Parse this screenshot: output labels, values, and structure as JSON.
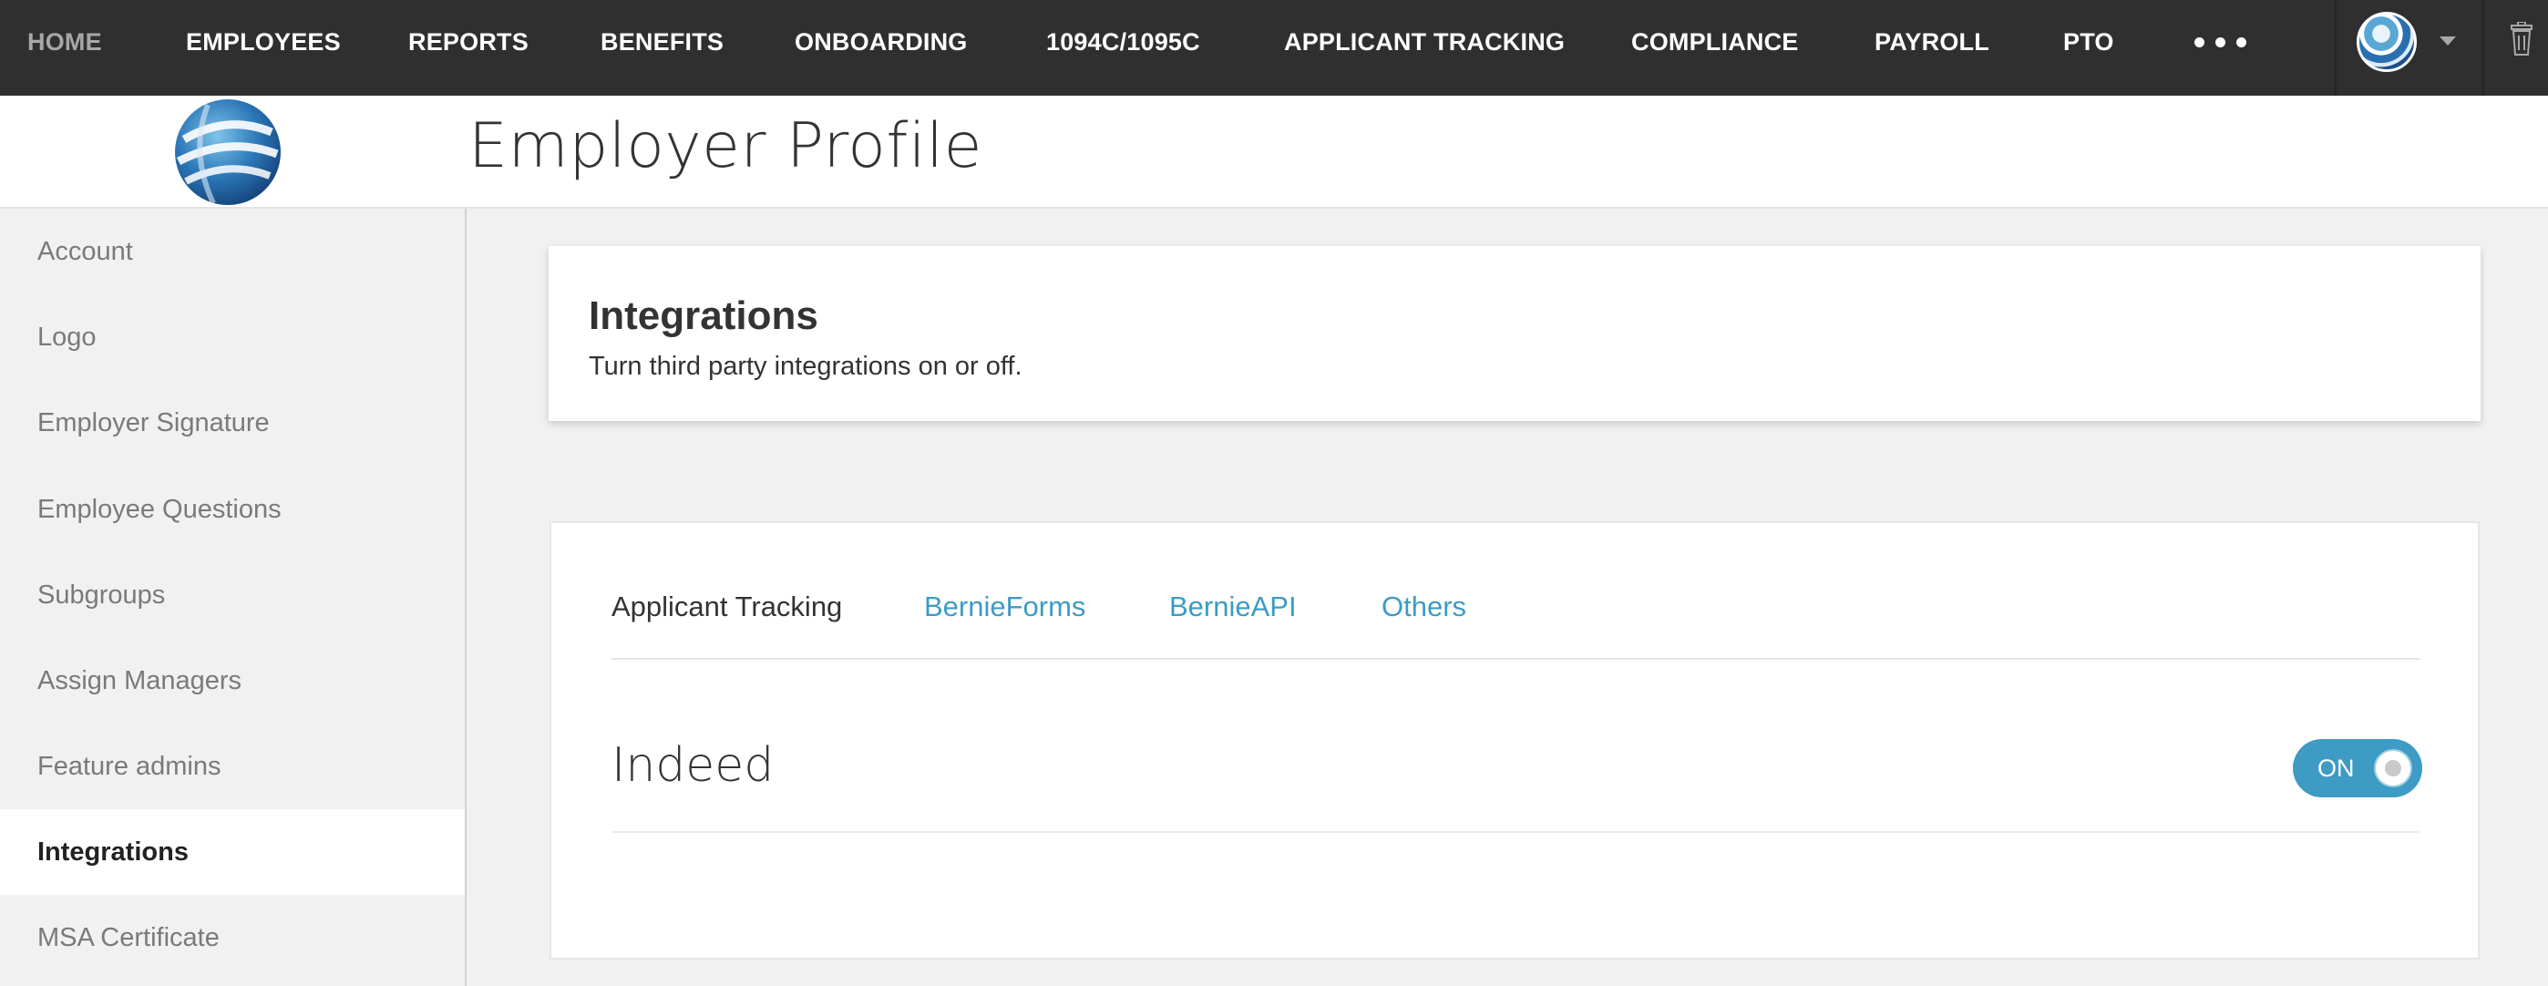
{
  "topnav": {
    "items": [
      {
        "label": "HOME"
      },
      {
        "label": "EMPLOYEES"
      },
      {
        "label": "REPORTS"
      },
      {
        "label": "BENEFITS"
      },
      {
        "label": "ONBOARDING"
      },
      {
        "label": "1094C/1095C"
      },
      {
        "label": "APPLICANT TRACKING"
      },
      {
        "label": "COMPLIANCE"
      },
      {
        "label": "PAYROLL"
      },
      {
        "label": "PTO"
      }
    ],
    "more_icon": "ellipsis-icon",
    "avatar_icon": "globe-logo-icon",
    "caret_icon": "caret-down-icon",
    "trash_icon": "trash-icon"
  },
  "header": {
    "logo_icon": "globe-logo-icon",
    "title": "Employer Profile"
  },
  "sidebar": {
    "items": [
      {
        "label": "Account"
      },
      {
        "label": "Logo"
      },
      {
        "label": "Employer Signature"
      },
      {
        "label": "Employee Questions"
      },
      {
        "label": "Subgroups"
      },
      {
        "label": "Assign Managers"
      },
      {
        "label": "Feature admins"
      },
      {
        "label": "Integrations"
      },
      {
        "label": "MSA Certificate"
      }
    ],
    "active": "Integrations"
  },
  "intro": {
    "title": "Integrations",
    "subtitle": "Turn third party integrations on or off."
  },
  "tabs": {
    "items": [
      {
        "label": "Applicant Tracking"
      },
      {
        "label": "BernieForms"
      },
      {
        "label": "BernieAPI"
      },
      {
        "label": "Others"
      }
    ],
    "active": "Applicant Tracking"
  },
  "integration": {
    "name": "Indeed",
    "toggle_label": "ON",
    "enabled": true
  },
  "colors": {
    "nav_bg": "#2f2f2f",
    "accent": "#3d9bc4",
    "page_bg": "#f1f1f1"
  }
}
